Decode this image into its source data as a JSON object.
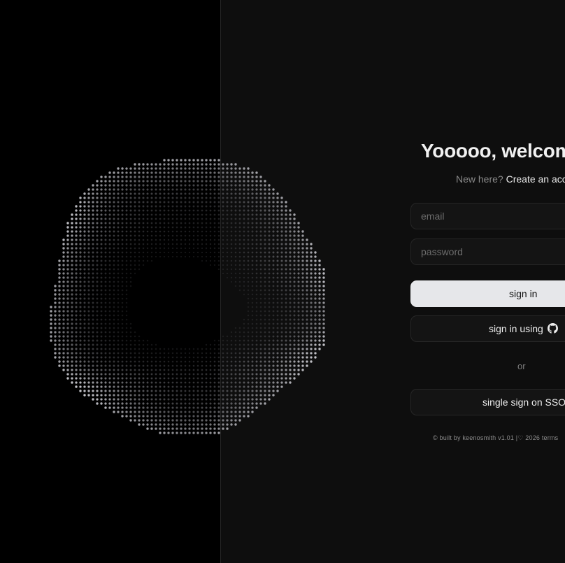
{
  "auth": {
    "title": "Yooooo, welcome",
    "subtitle_prefix": "New here? ",
    "create_account_link": "Create an acc",
    "email_placeholder": "email",
    "password_placeholder": "password",
    "sign_in_label": "sign in",
    "github_sign_in_label": "sign in using",
    "or_label": "or",
    "sso_label": "single sign on SSO",
    "footer": "© built by keenosmith v1.01 |♡ 2026 terms"
  },
  "icons": {
    "github": "github-icon",
    "orb": "particle-orb"
  },
  "colors": {
    "left_bg": "#000000",
    "right_bg": "#0e0e0e",
    "primary_button_bg": "#e6e7ea",
    "text_primary": "#f1f1f1",
    "text_muted": "#8a8a8a"
  }
}
